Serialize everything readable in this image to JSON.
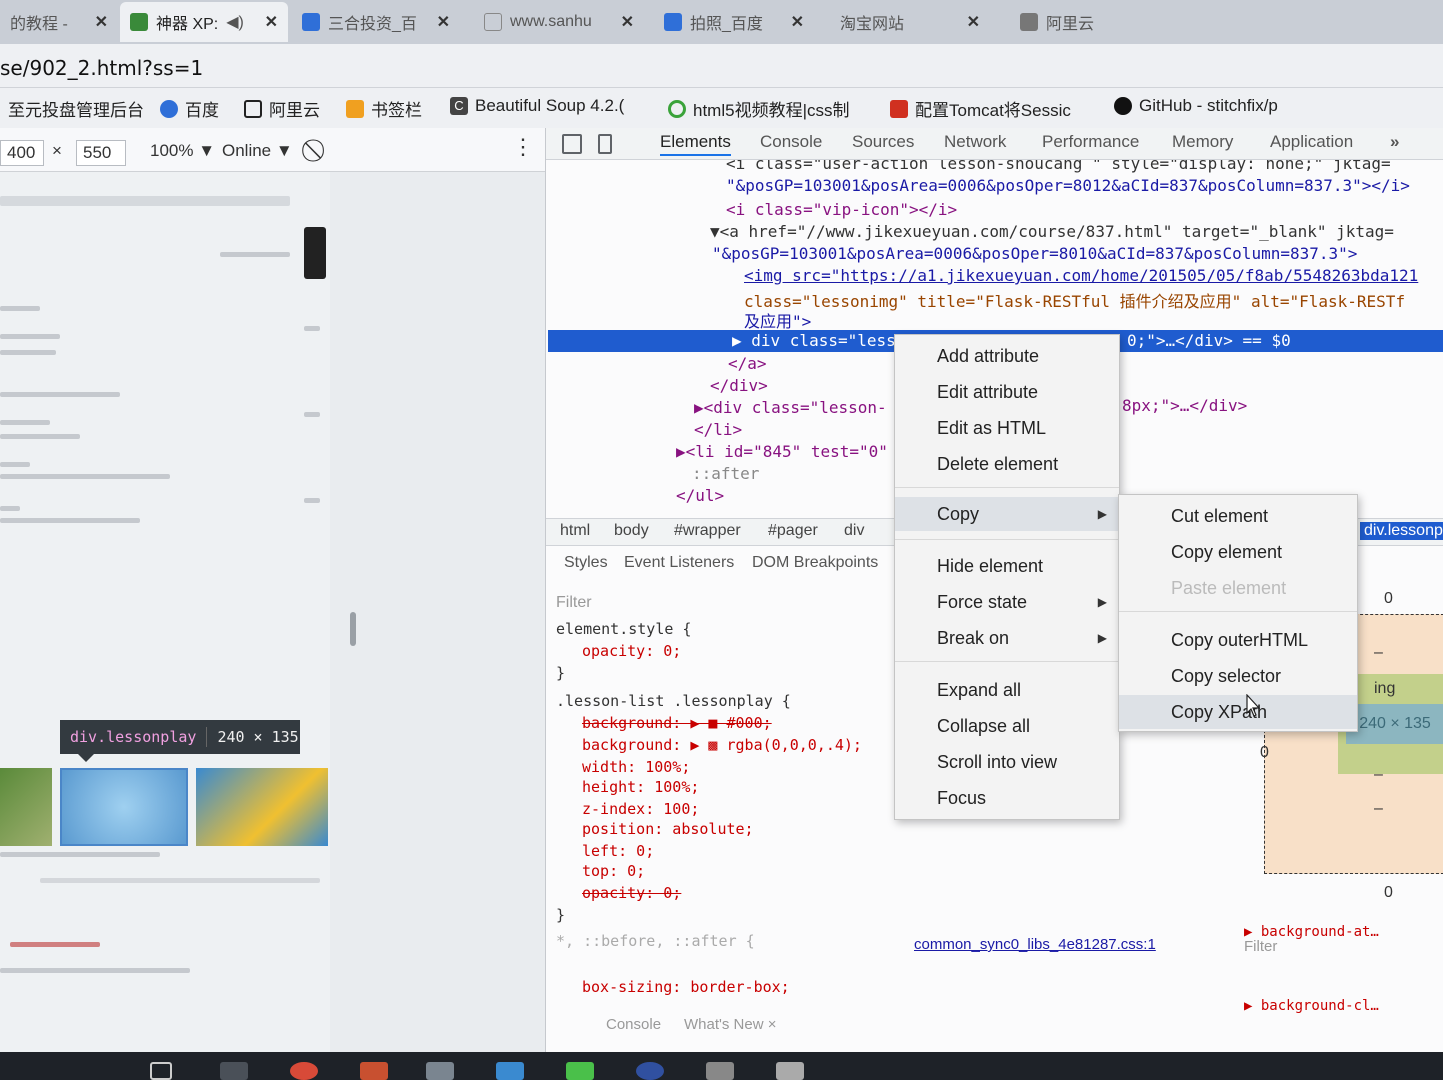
{
  "browser": {
    "tabs": [
      {
        "label": "的教程 -",
        "active": false
      },
      {
        "label": "神器 XP:",
        "active": true
      },
      {
        "label": "三合投资_百",
        "active": false
      },
      {
        "label": "www.sanhu",
        "active": false
      },
      {
        "label": "拍照_百度",
        "active": false
      },
      {
        "label": "淘宝网站",
        "active": false
      },
      {
        "label": "阿里云",
        "active": false
      }
    ],
    "url": "se/902_2.html?ss=1",
    "bookmarks": [
      {
        "label": "至元投盘管理后台",
        "icon": "page-icon"
      },
      {
        "label": "百度",
        "icon": "baidu-paw-icon"
      },
      {
        "label": "阿里云",
        "icon": "aliyun-icon"
      },
      {
        "label": "书签栏",
        "icon": "folder-icon"
      },
      {
        "label": "Beautiful Soup 4.2.(",
        "icon": "c-letter-icon"
      },
      {
        "label": "html5视频教程|css制",
        "icon": "refresh-icon"
      },
      {
        "label": "配置Tomcat将Sessic",
        "icon": "red-app-icon"
      },
      {
        "label": "GitHub - stitchfix/p",
        "icon": "github-icon"
      }
    ]
  },
  "device_toolbar": {
    "width": "400",
    "times": "×",
    "height": "550",
    "zoom": "100% ▼",
    "network": "Online ▼"
  },
  "viewport": {
    "tooltip_selector": "div.lessonplay",
    "tooltip_size": "240 × 135"
  },
  "devtools": {
    "tabs": [
      "Elements",
      "Console",
      "Sources",
      "Network",
      "Performance",
      "Memory",
      "Application"
    ],
    "active_tab": "Elements",
    "more": "»",
    "dom_lines": [
      "<i class=\"user-action lesson-shoucang \" style=\"display: none;\" jktag=",
      "\"&posGP=103001&posArea=0006&posOper=8012&aCId=837&posColumn=837.3\"></i>",
      "<i class=\"vip-icon\"></i>",
      "▼<a href=\"//www.jikexueyuan.com/course/837.html\" target=\"_blank\" jktag=",
      "\"&posGP=103001&posArea=0006&posOper=8010&aCId=837&posColumn=837.3\">",
      "<img src=\"https://a1.jikexueyuan.com/home/201505/05/f8ab/5548263bda121",
      "class=\"lessonimg\" title=\"Flask-RESTful 插件介绍及应用\" alt=\"Flask-RESTf",
      "及应用\">",
      "▶ div class=\"lessonplay\" style=\"opacity: 0;\">…</div> == $0",
      "</a>",
      "</div>",
      "▶<div class=\"lesson-",
      "</li>",
      "▶<li id=\"845\" test=\"0\"",
      "::after",
      "</ul>"
    ],
    "dom_side_fragment": "8px;\">…</div>",
    "breadcrumbs": [
      "html",
      "body",
      "#wrapper",
      "#pager",
      "div",
      "div.lessonpla"
    ],
    "subtabs": [
      "Styles",
      "Event Listeners",
      "DOM Breakpoints"
    ],
    "filter_placeholder": "Filter",
    "styles": [
      "element.style {",
      "opacity: 0;",
      "}",
      ".lesson-list .lessonplay {",
      "background: ▶ ■ #000;",
      "background: ▶ ▩ rgba(0,0,0,.4);",
      "width: 100%;",
      "height: 100%;",
      "z-index: 100;",
      "position: absolute;",
      "left: 0;",
      "top: 0;",
      "opacity: 0;",
      "}",
      "*, ::before, ::after {",
      "box-sizing: border-box;"
    ],
    "style_source": "common_sync0_libs_4e81287.css:1",
    "bottom_tabs": [
      "Console",
      "What's New ×"
    ],
    "computed_filter": "Filter",
    "computed": [
      "▶ background-at…",
      "▶ background-cl…"
    ],
    "box_model": {
      "margin": "0",
      "position_left": "0",
      "dash": "–",
      "content": "240 × 135",
      "bottom": "0",
      "label": "ing"
    }
  },
  "context_menu": {
    "items": [
      "Add attribute",
      "Edit attribute",
      "Edit as HTML",
      "Delete element",
      "Copy",
      "Hide element",
      "Force state",
      "Break on",
      "Expand all",
      "Collapse all",
      "Scroll into view",
      "Focus"
    ]
  },
  "copy_submenu": {
    "items": [
      "Cut element",
      "Copy element",
      "Paste element",
      "Copy outerHTML",
      "Copy selector",
      "Copy XPath"
    ]
  },
  "colors": {
    "selection": "#1f5ccf",
    "tag": "#881280",
    "attr": "#994500",
    "value": "#1a1aa6",
    "css_property": "#c80000"
  }
}
